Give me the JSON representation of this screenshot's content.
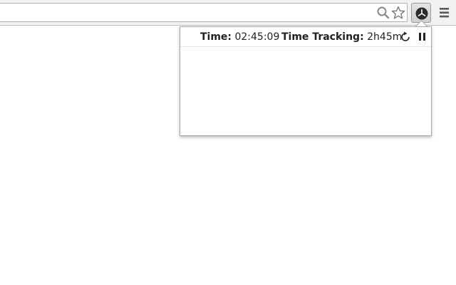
{
  "popup": {
    "time_label": "Time:",
    "time_value": "02:45:09",
    "tracking_label": "Time Tracking:",
    "tracking_value": "2h45m"
  },
  "icons": {
    "search": "search-icon",
    "star": "star-icon",
    "extension": "clock-icon",
    "menu": "hamburger-menu-icon",
    "reset": "reset-icon",
    "pause": "pause-icon"
  },
  "colors": {
    "toolbar_bg": "#f2f2f2",
    "popup_border": "#a8a8a8",
    "text": "#222222"
  }
}
